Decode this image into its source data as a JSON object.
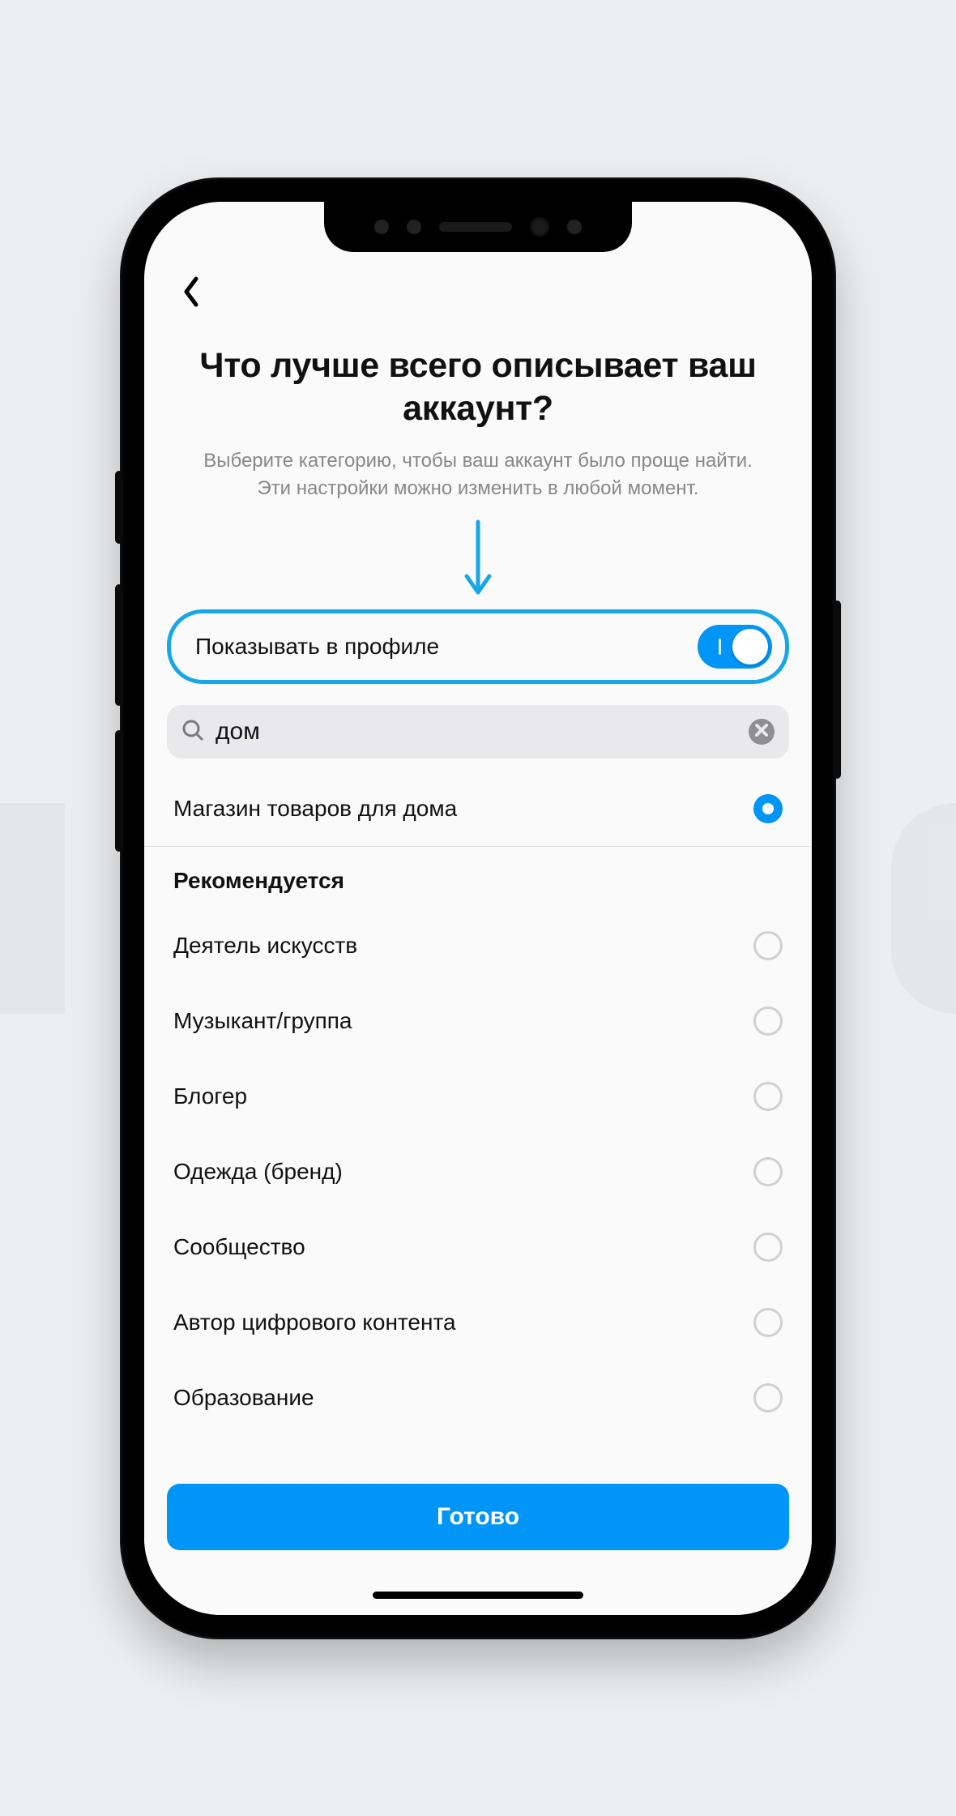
{
  "header": {
    "title": "Что лучше всего описывает ваш аккаунт?",
    "subtitle": "Выберите категорию, чтобы ваш аккаунт было проще найти. Эти настройки можно изменить в любой момент."
  },
  "toggle": {
    "label": "Показывать в профиле",
    "on": true
  },
  "search": {
    "value": "дом",
    "placeholder": ""
  },
  "selected_category": {
    "label": "Магазин товаров для дома",
    "selected": true
  },
  "recommended_header": "Рекомендуется",
  "recommended": [
    {
      "label": "Деятель искусств"
    },
    {
      "label": "Музыкант/группа"
    },
    {
      "label": "Блогер"
    },
    {
      "label": "Одежда (бренд)"
    },
    {
      "label": "Сообщество"
    },
    {
      "label": "Автор цифрового контента"
    },
    {
      "label": "Образование"
    }
  ],
  "footer": {
    "done_label": "Готово"
  },
  "colors": {
    "accent": "#0095f6",
    "highlight_border": "#17a6e6"
  }
}
